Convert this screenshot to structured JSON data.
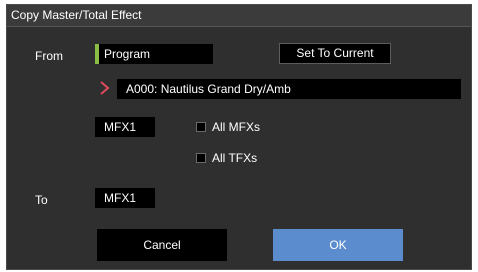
{
  "dialog": {
    "title": "Copy Master/Total Effect"
  },
  "from": {
    "label": "From",
    "source_type": "Program",
    "set_to_current_label": "Set To Current",
    "program": "A000: Nautilus Grand Dry/Amb",
    "effect": "MFX1",
    "all_mfxs_label": "All MFXs",
    "all_tfxs_label": "All TFXs"
  },
  "to": {
    "label": "To",
    "effect": "MFX1"
  },
  "buttons": {
    "cancel_label": "Cancel",
    "ok_label": "OK"
  },
  "colors": {
    "background": "#2f2f2f",
    "field": "#000000",
    "accent_ok": "#5b8dce",
    "program_marker": "#8bbd46",
    "chevron": "#e04a5a"
  }
}
